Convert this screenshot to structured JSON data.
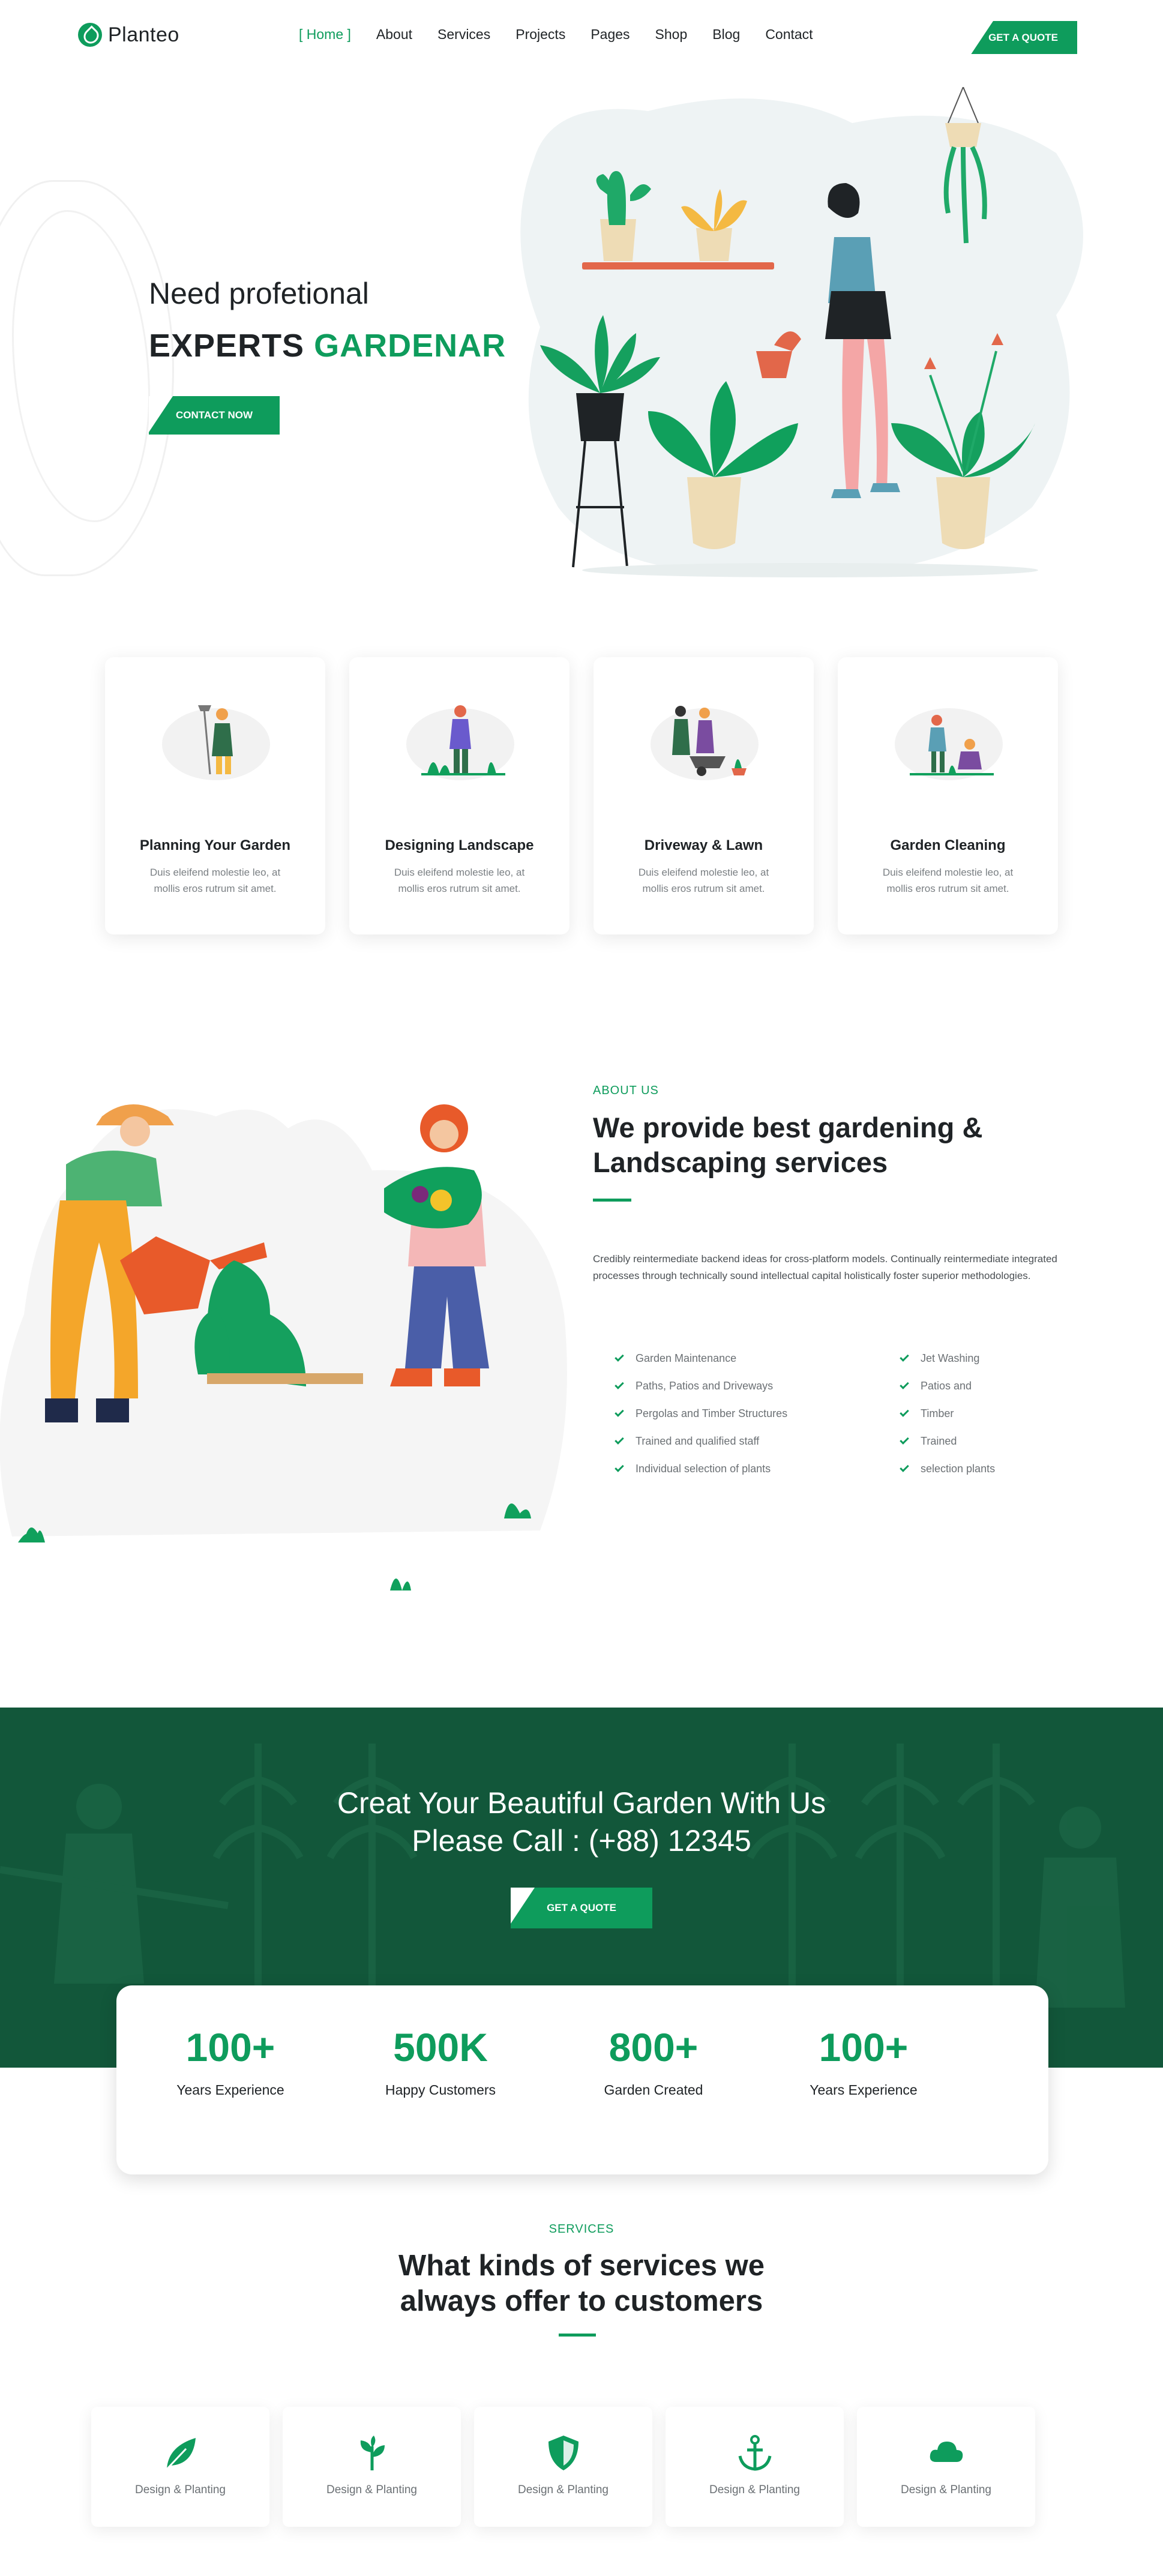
{
  "brand": {
    "name": "Planteo"
  },
  "nav": {
    "items": [
      "Home",
      "About",
      "Services",
      "Projects",
      "Pages",
      "Shop",
      "Blog",
      "Contact"
    ],
    "active": "Home",
    "cta": "GET A QUOTE"
  },
  "hero": {
    "subtitle": "Need profetional",
    "title_plain": "EXPERTS",
    "title_accent": "GARDENAR",
    "button": "CONTACT NOW"
  },
  "features": [
    {
      "title": "Planning Your Garden",
      "text": "Duis eleifend molestie leo, at mollis eros rutrum sit amet."
    },
    {
      "title": "Designing Landscape",
      "text": "Duis eleifend molestie leo, at mollis eros rutrum sit amet."
    },
    {
      "title": "Driveway & Lawn",
      "text": "Duis eleifend molestie leo, at mollis eros rutrum sit amet."
    },
    {
      "title": "Garden Cleaning",
      "text": "Duis eleifend molestie leo, at mollis eros rutrum sit amet."
    }
  ],
  "about": {
    "label": "ABOUT US",
    "title": "We provide best gardening & Landscaping services",
    "description": "Credibly reintermediate backend ideas for cross-platform models. Continually reintermediate integrated processes through technically sound intellectual capital holistically foster superior methodologies.",
    "list_left": [
      "Garden Maintenance",
      "Paths, Patios and Driveways",
      "Pergolas and Timber Structures",
      "Trained and qualified staff",
      "Individual selection of plants"
    ],
    "list_right": [
      "Jet Washing",
      "Patios and",
      "Timber",
      "Trained",
      "selection plants"
    ]
  },
  "cta": {
    "line1": "Creat Your Beautiful Garden With Us",
    "line2": "Please Call : (+88) 12345",
    "button": "GET A QUOTE"
  },
  "stats": [
    {
      "value": "100+",
      "label": "Years Experience"
    },
    {
      "value": "500K",
      "label": "Happy Customers"
    },
    {
      "value": "800+",
      "label": "Garden Created"
    },
    {
      "value": "100+",
      "label": "Years Experience"
    }
  ],
  "services": {
    "label": "SERVICES",
    "title_line1": "What kinds of services we",
    "title_line2": "always offer to customers",
    "items": [
      {
        "icon": "leaf-icon",
        "label": "Design & Planting"
      },
      {
        "icon": "sprout-icon",
        "label": "Design & Planting"
      },
      {
        "icon": "shield-icon",
        "label": "Design & Planting"
      },
      {
        "icon": "anchor-icon",
        "label": "Design & Planting"
      },
      {
        "icon": "cloud-icon",
        "label": "Design & Planting"
      }
    ]
  },
  "colors": {
    "accent": "#0e9c5c",
    "dark_green": "#12573a",
    "text": "#1f2326"
  }
}
